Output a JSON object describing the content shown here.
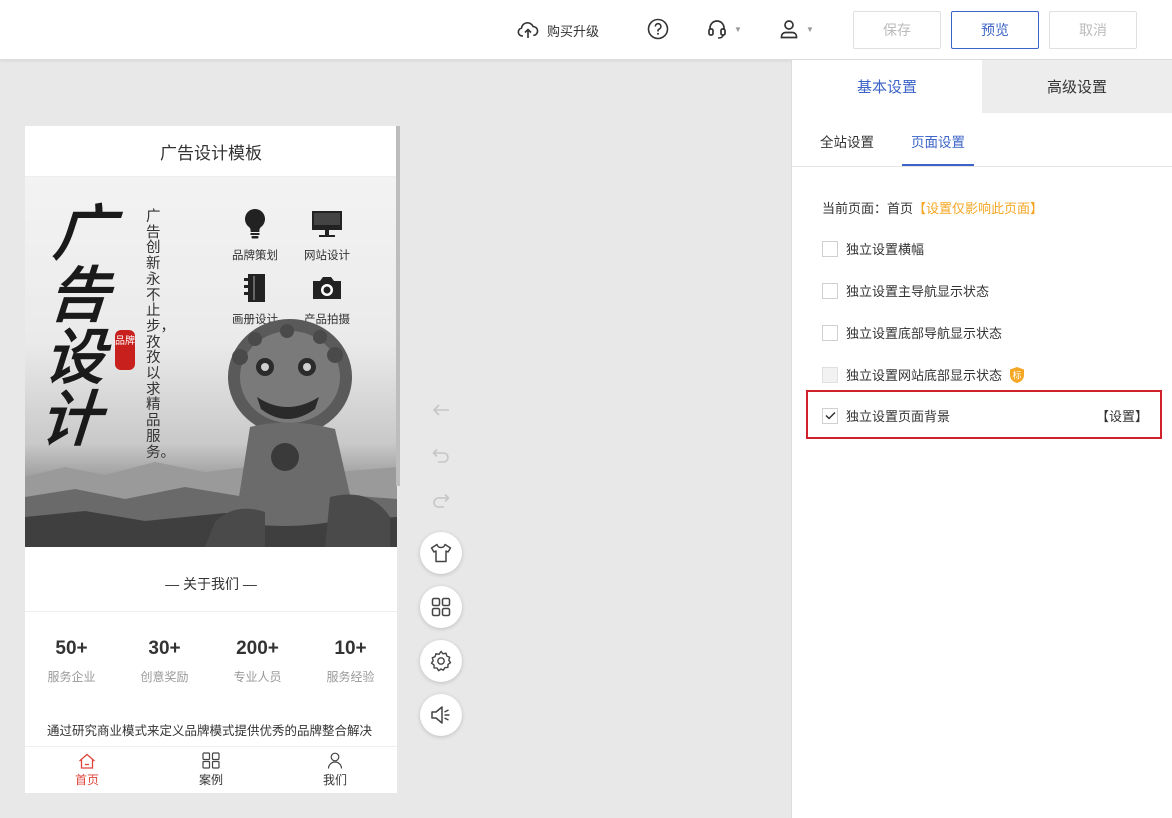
{
  "topbar": {
    "upgrade_label": "购买升级",
    "save_label": "保存",
    "preview_label": "预览",
    "cancel_label": "取消"
  },
  "phone": {
    "title": "广告设计模板",
    "banner": {
      "big_title": "广告设计",
      "seal_text": "品牌",
      "slogan": "广告创新永不止步，孜孜以求精品服务。",
      "features": [
        {
          "label": "品牌策划",
          "icon": "lightbulb-icon"
        },
        {
          "label": "网站设计",
          "icon": "monitor-icon"
        },
        {
          "label": "画册设计",
          "icon": "notebook-icon"
        },
        {
          "label": "产品拍摄",
          "icon": "camera-icon"
        }
      ]
    },
    "about_title": "— 关于我们 —",
    "stats": [
      {
        "num": "50+",
        "caption": "服务企业"
      },
      {
        "num": "30+",
        "caption": "创意奖励"
      },
      {
        "num": "200+",
        "caption": "专业人员"
      },
      {
        "num": "10+",
        "caption": "服务经验"
      }
    ],
    "about_text": "通过研究商业模式来定义品牌模式提供优秀的品牌整合解决方案，令品牌长远发展，更具竞争力新成立企业，需要有好的标",
    "tabbar": [
      {
        "label": "首页",
        "icon": "home-icon"
      },
      {
        "label": "案例",
        "icon": "grid-icon"
      },
      {
        "label": "我们",
        "icon": "user-icon"
      }
    ]
  },
  "panel": {
    "tabs": {
      "basic": "基本设置",
      "advanced": "高级设置"
    },
    "subtabs": {
      "site": "全站设置",
      "page": "页面设置"
    },
    "current_page_label": "当前页面：首页",
    "current_page_note": "【设置仅影响此页面】",
    "options": [
      {
        "label": "独立设置横幅",
        "checked": false
      },
      {
        "label": "独立设置主导航显示状态",
        "checked": false
      },
      {
        "label": "独立设置底部导航显示状态",
        "checked": false
      },
      {
        "label": "独立设置网站底部显示状态",
        "checked": false,
        "badge": "标"
      },
      {
        "label": "独立设置页面背景",
        "checked": true
      }
    ],
    "set_link": "【设置】"
  },
  "colors": {
    "accent": "#3c64c8",
    "highlight_border": "#d0222b",
    "active_tab": "#e0463c",
    "orange_note": "#f5a623"
  }
}
